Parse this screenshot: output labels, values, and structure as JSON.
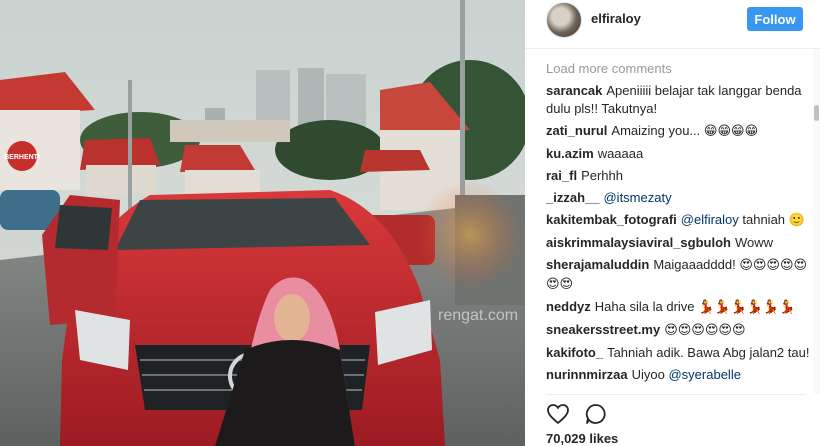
{
  "post": {
    "username": "elfiraloy",
    "follow_label": "Follow",
    "load_more_label": "Load more comments",
    "likes_text": "70,029 likes",
    "photo_overlay_sign": "BERHENTI",
    "photo_watermark": "rengat.com"
  },
  "comments": [
    {
      "user": "sarancak",
      "parts": [
        {
          "t": "text",
          "v": "Apeniiiii belajar tak langgar benda dulu pls!! Takutnya!"
        }
      ]
    },
    {
      "user": "zati_nurul",
      "parts": [
        {
          "t": "text",
          "v": "Amaizing you... "
        },
        {
          "t": "emoji",
          "v": "😁😁😁😁"
        }
      ]
    },
    {
      "user": "ku.azim",
      "parts": [
        {
          "t": "text",
          "v": "waaaaa"
        }
      ]
    },
    {
      "user": "rai_fl",
      "parts": [
        {
          "t": "text",
          "v": "Perhhh"
        }
      ]
    },
    {
      "user": "_izzah__",
      "parts": [
        {
          "t": "mention",
          "v": "@itsmezaty"
        }
      ]
    },
    {
      "user": "kakitembak_fotografi",
      "parts": [
        {
          "t": "mention",
          "v": "@elfiraloy"
        },
        {
          "t": "text",
          "v": " tahniah "
        },
        {
          "t": "emoji",
          "v": "🙂"
        }
      ]
    },
    {
      "user": "aiskrimmalaysiaviral_sgbuloh",
      "parts": [
        {
          "t": "text",
          "v": "Woww"
        }
      ]
    },
    {
      "user": "sherajamaluddin",
      "parts": [
        {
          "t": "text",
          "v": "Maigaaadddd! "
        },
        {
          "t": "emoji",
          "v": "😍😍😍😍😍😍😍"
        }
      ]
    },
    {
      "user": "neddyz",
      "parts": [
        {
          "t": "text",
          "v": "Haha sila la drive "
        },
        {
          "t": "emoji",
          "v": "💃💃💃💃💃💃"
        }
      ]
    },
    {
      "user": "sneakersstreet.my",
      "parts": [
        {
          "t": "emoji",
          "v": "😍😍😍😍😍😍"
        }
      ]
    },
    {
      "user": "kakifoto_",
      "parts": [
        {
          "t": "text",
          "v": "Tahniah adik. Bawa Abg jalan2 tau!"
        }
      ]
    },
    {
      "user": "nurinnmirzaa",
      "parts": [
        {
          "t": "text",
          "v": "Uiyoo "
        },
        {
          "t": "mention",
          "v": "@syerabelle"
        }
      ]
    }
  ],
  "icons": {
    "like": "heart-icon",
    "comment": "comment-bubble-icon"
  },
  "colors": {
    "follow_bg": "#3897f0",
    "mention": "#003569",
    "car_red": "#c8262b"
  }
}
